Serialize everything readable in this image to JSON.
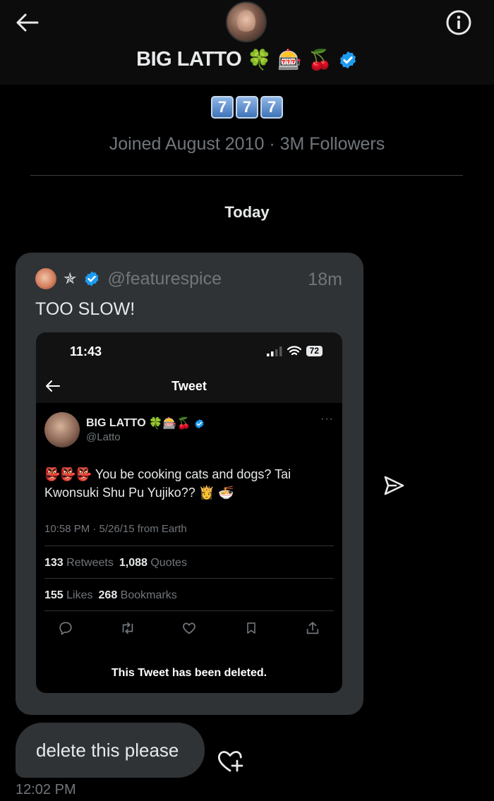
{
  "header": {
    "profile_name": "BIG LATTO",
    "name_emojis": [
      "🍀",
      "🎰",
      "🍒"
    ],
    "bio_keycaps": [
      "7",
      "7",
      "7"
    ],
    "meta_joined": "Joined August 2010",
    "meta_sep": "·",
    "meta_followers": "3M Followers"
  },
  "conversation": {
    "day_label": "Today",
    "shared_post": {
      "star": "✯",
      "handle": "@featurespice",
      "time": "18m",
      "text": "TOO SLOW!",
      "screenshot": {
        "status_time": "11:43",
        "battery": "72",
        "nav_title": "Tweet",
        "author_name": "BIG LATTO",
        "author_emojis": "🍀🎰🍒",
        "author_handle": "@Latto",
        "more": "···",
        "body": "👺👺👺 You be cooking cats and dogs? Tai Kwonsuki Shu Pu Yujiko?? 👸 🍜",
        "timestamp": "10:58 PM · 5/26/15 from Earth",
        "retweets_count": "133",
        "retweets_label": "Retweets",
        "quotes_count": "1,088",
        "quotes_label": "Quotes",
        "likes_count": "155",
        "likes_label": "Likes",
        "bookmarks_count": "268",
        "bookmarks_label": "Bookmarks",
        "deleted_notice": "This Tweet has been deleted."
      }
    },
    "message": {
      "text": "delete this please",
      "time": "12:02 PM"
    }
  },
  "colors": {
    "background": "#000000",
    "bubble": "#2f3336",
    "muted_text": "#71767b",
    "verified_blue": "#1d9bf0"
  },
  "icons": [
    "back-arrow-icon",
    "info-icon",
    "verified-badge-icon",
    "send-icon",
    "add-reaction-icon",
    "reply-icon",
    "retweet-icon",
    "like-icon",
    "bookmark-icon",
    "share-icon"
  ]
}
